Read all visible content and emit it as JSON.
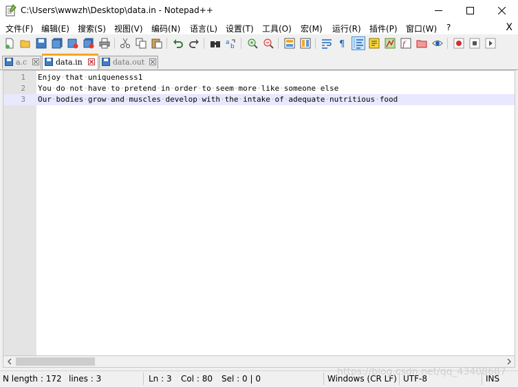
{
  "window": {
    "title": "C:\\Users\\wwwzh\\Desktop\\data.in - Notepad++"
  },
  "menu": {
    "items": [
      "文件(F)",
      "编辑(E)",
      "搜索(S)",
      "视图(V)",
      "编码(N)",
      "语言(L)",
      "设置(T)",
      "工具(O)",
      "宏(M)",
      "运行(R)",
      "插件(P)",
      "窗口(W)",
      "?"
    ],
    "close_glyph": "X"
  },
  "tabs": [
    {
      "label": "a.c",
      "active": false
    },
    {
      "label": "data.in",
      "active": true
    },
    {
      "label": "data.out",
      "active": false
    }
  ],
  "editor": {
    "current_line": 3,
    "lines": [
      {
        "num": "1",
        "text": "Enjoy that uniquenesss1"
      },
      {
        "num": "2",
        "text": "You do not have to pretend in order to seem more like someone else"
      },
      {
        "num": "3",
        "text": "Our bodies grow and muscles develop with the intake of adequate nutritious food"
      }
    ]
  },
  "status": {
    "length": "N length : 172",
    "lines": "lines : 3",
    "ln": "Ln : 3",
    "col": "Col : 80",
    "sel": "Sel : 0 | 0",
    "eol": "Windows (CR LF)",
    "encoding": "UTF-8",
    "mode": "INS"
  },
  "watermark": "https://blog.csdn.net/qq_43408687",
  "colors": {
    "active_tab_accent": "#f5a623",
    "current_line_bg": "#e8e8ff",
    "gutter_bg": "#e4e4e4"
  }
}
